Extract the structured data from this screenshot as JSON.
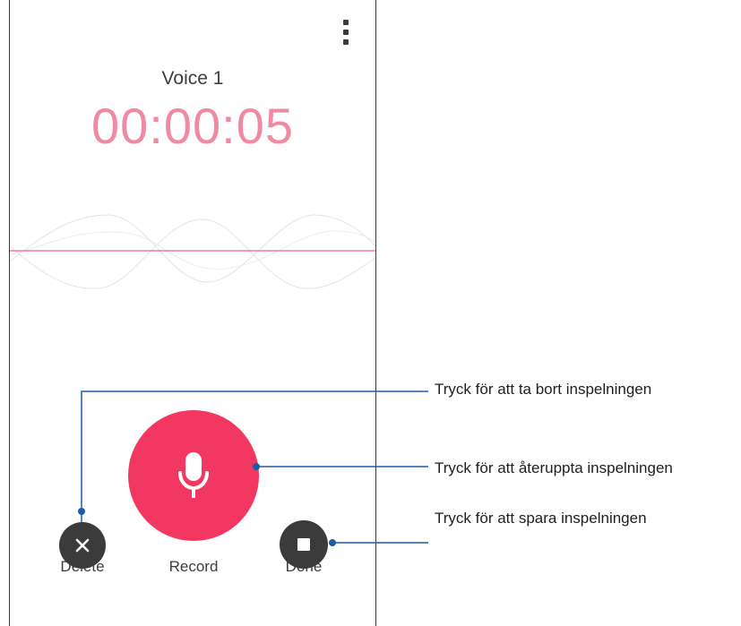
{
  "recording": {
    "title": "Voice 1",
    "elapsed": "00:00:05"
  },
  "controls": {
    "delete_label": "Delete",
    "record_label": "Record",
    "done_label": "Done"
  },
  "callouts": {
    "delete": "Tryck för att ta bort inspelningen",
    "resume": "Tryck för att återuppta inspelningen",
    "save": "Tryck för att spara inspelningen"
  },
  "icons": {
    "menu": "more-vertical-icon",
    "delete": "close-icon",
    "record": "microphone-icon",
    "done": "stop-icon"
  },
  "colors": {
    "accent": "#f23760",
    "timer": "#f08aa2",
    "dark_button": "#3b3b3b",
    "callout_line": "#1a5ea8"
  }
}
